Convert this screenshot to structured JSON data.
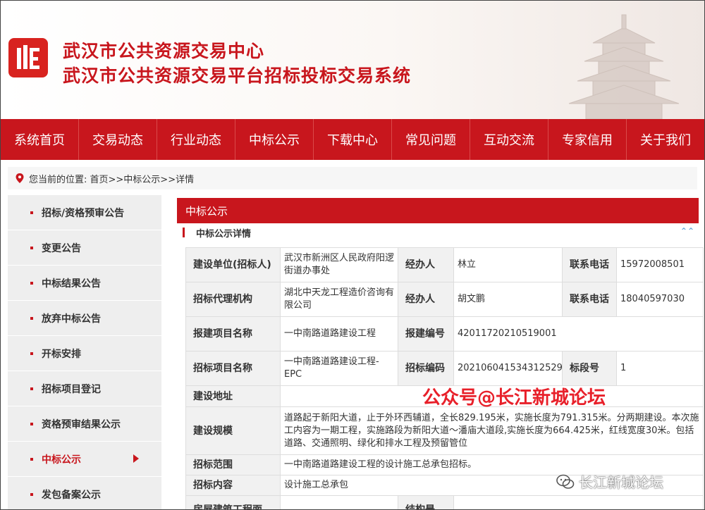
{
  "header": {
    "title_line1": "武汉市公共资源交易中心",
    "title_line2": "武汉市公共资源交易平台招标投标交易系统"
  },
  "nav": [
    "系统首页",
    "交易动态",
    "行业动态",
    "中标公示",
    "下载中心",
    "常见问题",
    "互动交流",
    "专家信用",
    "关于我们"
  ],
  "breadcrumb": "您当前的位置: 首页>>中标公示>>详情",
  "sidebar": {
    "items": [
      "招标/资格预审公告",
      "变更公告",
      "中标结果公告",
      "放弃中标公告",
      "开标安排",
      "招标项目登记",
      "资格预审结果公示",
      "中标公示",
      "发包备案公示"
    ],
    "active_index": 7
  },
  "main": {
    "heading": "中标公示",
    "subheading": "中标公示详情"
  },
  "detail": {
    "r1": {
      "k1": "建设单位(招标人)",
      "v1": "武汉市新洲区人民政府阳逻街道办事处",
      "k2": "经办人",
      "v2": "林立",
      "k3": "联系电话",
      "v3": "15972008501"
    },
    "r2": {
      "k1": "招标代理机构",
      "v1": "湖北中天龙工程造价咨询有限公司",
      "k2": "经办人",
      "v2": "胡文鹏",
      "k3": "联系电话",
      "v3": "18040597030"
    },
    "r3": {
      "k1": "报建项目名称",
      "v1": "一中南路道路建设工程",
      "k2": "报建编号",
      "v2": "42011720210519001"
    },
    "r4": {
      "k1": "招标项目名称",
      "v1": "一中南路道路建设工程-EPC",
      "k2": "招标编码",
      "v2": "202106041534312529",
      "k3": "标段号",
      "v3": "1"
    },
    "r5": {
      "k1": "建设地址",
      "v1": ""
    },
    "r6": {
      "k1": "建设规模",
      "v1": "道路起于新阳大道，止于外环西辅道，全长829.195米，实施长度为791.315米。分两期建设。本次施工内容为一期工程，实施路段为新阳大道～潘庙大道段,实施长度为664.425米，红线宽度30米。包括道路、交通照明、绿化和排水工程及预留管位"
    },
    "r7": {
      "k1": "招标范围",
      "v1": "一中南路道路建设工程的设计施工总承包招标。"
    },
    "r8": {
      "k1": "招标内容",
      "v1": "设计施工总承包"
    },
    "r9": {
      "k1": "房屋建筑工程面",
      "k2": "结构是"
    }
  },
  "watermark": {
    "red": "公众号@长江新城论坛",
    "gray": "长江新城论坛"
  },
  "colors": {
    "brand_red": "#c8161d",
    "sidebar_bg": "#eeeeee",
    "key_cell_bg": "#f1f1f1"
  }
}
